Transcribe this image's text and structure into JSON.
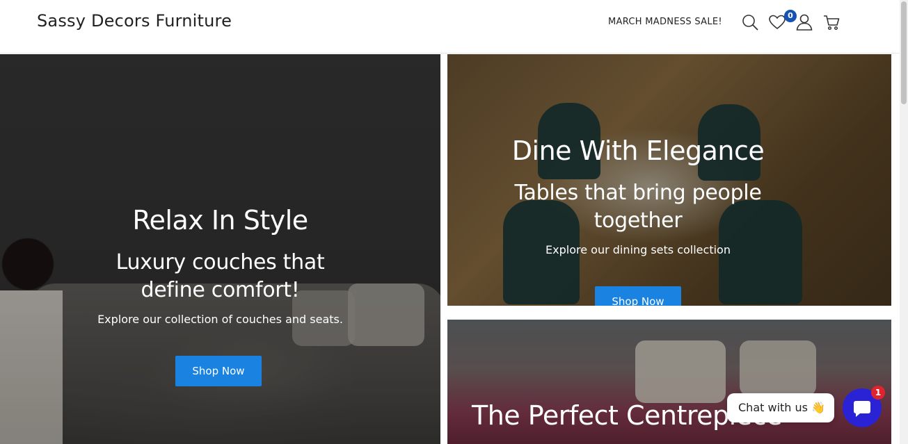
{
  "header": {
    "logo": "Sassy Decors Furniture",
    "promo": "MARCH MADNESS SALE!",
    "wishlist_count": "0",
    "icons": [
      "search-icon",
      "heart-icon",
      "user-icon",
      "cart-icon"
    ]
  },
  "hero_left": {
    "title": "Relax In Style",
    "subtitle_line1": "Luxury couches that",
    "subtitle_line2": "define comfort!",
    "description": "Explore our collection of couches and seats.",
    "button": "Shop Now"
  },
  "hero_right_top": {
    "title": "Dine With Elegance",
    "subtitle_line1": "Tables that bring people",
    "subtitle_line2": "together",
    "description": "Explore our dining sets collection",
    "button": "Shop Now"
  },
  "hero_right_bottom": {
    "title": "The Perfect Centrepiece"
  },
  "chat": {
    "label": "Chat with us 👋",
    "unread": "1"
  },
  "colors": {
    "accent_button": "#1a83e2",
    "badge": "#1652b4",
    "chat": "#2a23d6",
    "chat_badge": "#e0242f"
  }
}
